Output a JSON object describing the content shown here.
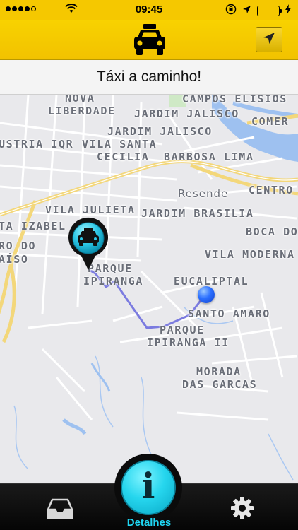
{
  "status_bar": {
    "time": "09:45",
    "signal_bars": 4,
    "signal_total": 5,
    "battery_level": 0.7,
    "battery_color": "#2bd431"
  },
  "header": {
    "logo_icon": "taxi-icon",
    "locate_icon": "location-arrow-icon",
    "background_color": "#f5c800"
  },
  "banner": {
    "text": "Táxi a caminho!"
  },
  "map": {
    "labels": [
      "NOVA",
      "LIBERDADE",
      "CAMPOS ELISIOS",
      "JARDIM JALISCO",
      "COMER",
      "JARDIM JALISCO",
      "USTRIA IQR",
      "VILA SANTA",
      "CECILIA",
      "BARBOSA LIMA",
      "Resende",
      "CENTRO",
      "VILA JULIETA",
      "JARDIM BRASILIA",
      "TA IZABEL",
      "BOCA DO",
      "RO DO",
      "AÍSO",
      "VILA MODERNA",
      "PARQUE",
      "IPIRANGA",
      "EUCALIPTAL",
      "SANTO AMARO",
      "PARQUE",
      "IPIRANGA II",
      "MORADA",
      "DAS GARCAS"
    ],
    "taxi_marker_icon": "taxi-pin-icon",
    "destination_marker_icon": "destination-dot-icon",
    "route_color": "#7b7be0"
  },
  "tab_bar": {
    "left_icon": "inbox-tray-icon",
    "center_icon": "info-icon",
    "center_label": "Detalhes",
    "right_icon": "gear-icon",
    "accent_color": "#1fd6f2"
  }
}
